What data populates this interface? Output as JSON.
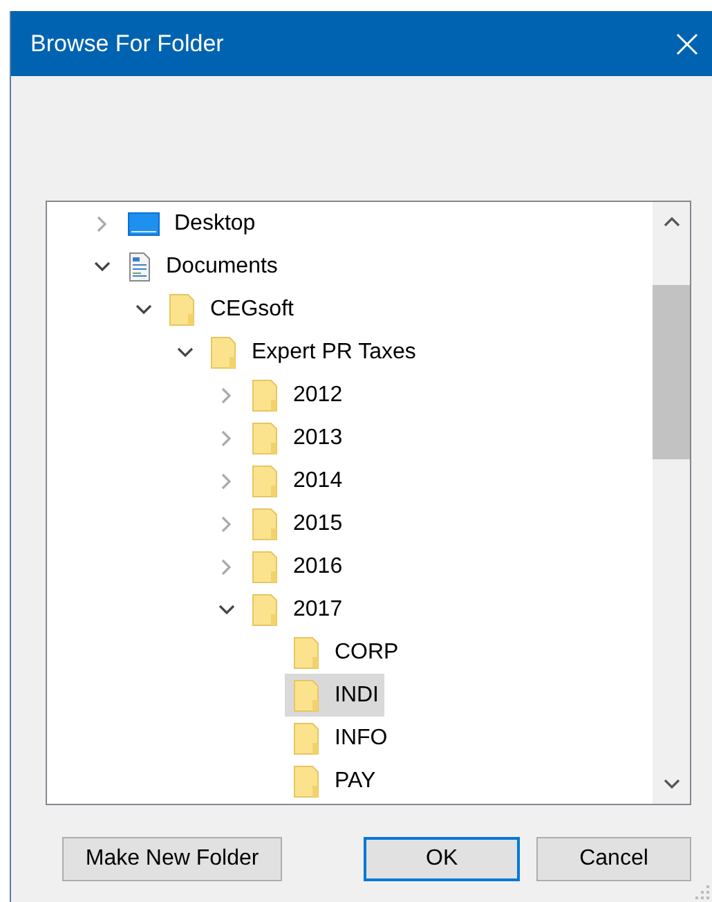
{
  "window": {
    "title": "Browse For Folder"
  },
  "tree": [
    {
      "label": "Desktop",
      "kind": "desktop",
      "expanded": false,
      "selected": false
    },
    {
      "label": "Documents",
      "kind": "documents",
      "expanded": true,
      "selected": false,
      "children": [
        {
          "label": "CEGsoft",
          "kind": "folder",
          "expanded": true,
          "selected": false,
          "children": [
            {
              "label": "Expert PR Taxes",
              "kind": "folder",
              "expanded": true,
              "selected": false,
              "children": [
                {
                  "label": "2012",
                  "kind": "folder",
                  "expanded": false,
                  "selected": false
                },
                {
                  "label": "2013",
                  "kind": "folder",
                  "expanded": false,
                  "selected": false
                },
                {
                  "label": "2014",
                  "kind": "folder",
                  "expanded": false,
                  "selected": false
                },
                {
                  "label": "2015",
                  "kind": "folder",
                  "expanded": false,
                  "selected": false
                },
                {
                  "label": "2016",
                  "kind": "folder",
                  "expanded": false,
                  "selected": false
                },
                {
                  "label": "2017",
                  "kind": "folder",
                  "expanded": true,
                  "selected": false,
                  "children": [
                    {
                      "label": "CORP",
                      "kind": "folder",
                      "selected": false
                    },
                    {
                      "label": "INDI",
                      "kind": "folder",
                      "selected": true
                    },
                    {
                      "label": "INFO",
                      "kind": "folder",
                      "selected": false
                    },
                    {
                      "label": "PAY",
                      "kind": "folder",
                      "selected": false
                    }
                  ]
                }
              ]
            }
          ]
        }
      ]
    }
  ],
  "buttons": [
    {
      "label": "Make New Folder",
      "default": false
    },
    {
      "label": "OK",
      "default": true
    },
    {
      "label": "Cancel",
      "default": false
    }
  ]
}
